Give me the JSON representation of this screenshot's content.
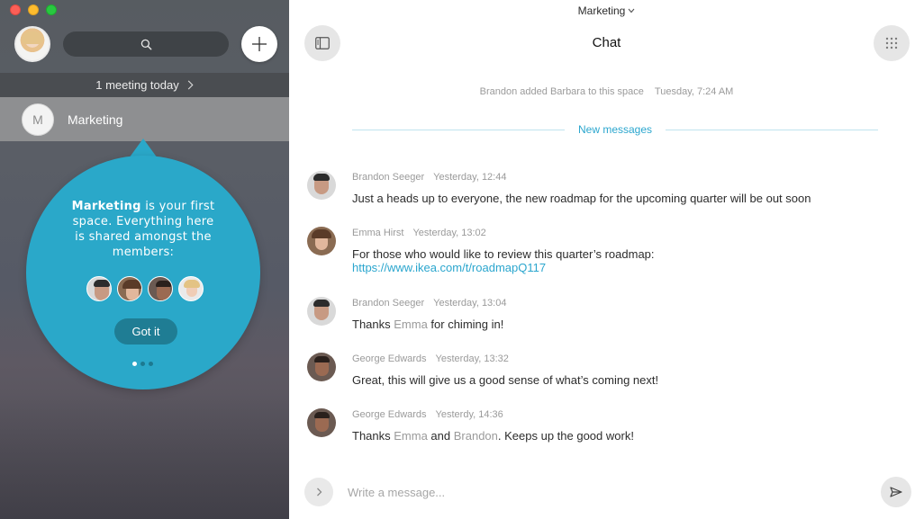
{
  "colors": {
    "accent": "#2ba6ce",
    "bubble": "#2aa8c9",
    "bubble_button": "#1f7d94",
    "sidebar_selected": "#8e8f91"
  },
  "sidebar": {
    "meeting_banner": "1 meeting today",
    "spaces": [
      {
        "initial": "M",
        "name": "Marketing"
      }
    ]
  },
  "onboarding": {
    "space_name": "Marketing",
    "text": " is your first space. Everything here is shared amongst the members:",
    "button_label": "Got it",
    "page_count": 3,
    "active_page": 1
  },
  "header": {
    "space_switcher": "Marketing",
    "title": "Chat"
  },
  "system_message": {
    "text": "Brandon added Barbara to this space",
    "time": "Tuesday, 7:24 AM"
  },
  "new_messages_label": "New messages",
  "messages": [
    {
      "author": "Brandon Seeger",
      "time": "Yesterday, 12:44",
      "text": "Just a heads up to everyone, the new roadmap for the upcoming quarter will be out soon"
    },
    {
      "author": "Emma Hirst",
      "time": "Yesterday, 13:02",
      "text": "For those who would like to review this quarter’s roadmap:",
      "link": "https://www.ikea.com/t/roadmapQ117"
    },
    {
      "author": "Brandon Seeger",
      "time": "Yesterday, 13:04",
      "parts": [
        "Thanks ",
        "Emma",
        " for chiming in!"
      ]
    },
    {
      "author": "George Edwards",
      "time": "Yesterday, 13:32",
      "text": "Great, this will give us a good sense of what’s coming next!"
    },
    {
      "author": "George Edwards",
      "time": "Yesterdy, 14:36",
      "parts": [
        "Thanks ",
        "Emma",
        " and ",
        "Brandon",
        ". Keeps up the good work!"
      ]
    }
  ],
  "composer": {
    "placeholder": "Write a message..."
  }
}
